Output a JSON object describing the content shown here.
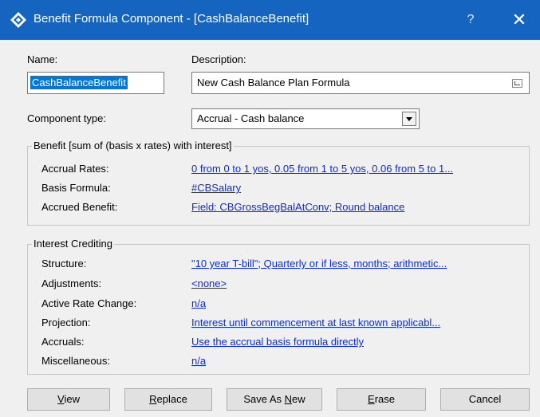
{
  "window": {
    "title": "Benefit Formula Component - [CashBalanceBenefit]",
    "help": "?",
    "close": "✕"
  },
  "colors": {
    "titlebar": "#1565c0",
    "link": "#0b2cdb",
    "selection": "#0078d7"
  },
  "name": {
    "label": "Name:",
    "value": "CashBalanceBenefit"
  },
  "description": {
    "label": "Description:",
    "value": "New Cash Balance Plan Formula"
  },
  "component_type": {
    "label": "Component type:",
    "value": "Accrual - Cash balance"
  },
  "benefit": {
    "title": "Benefit  [sum of (basis x rates) with interest]",
    "rows": [
      {
        "label": "Accrual Rates:",
        "value": "0 from 0 to 1 yos, 0.05 from 1 to 5 yos, 0.06 from 5 to 1..."
      },
      {
        "label": "Basis Formula:",
        "value": "#CBSalary"
      },
      {
        "label": "Accrued Benefit:",
        "value": "Field: CBGrossBegBalAtConv; Round balance"
      }
    ]
  },
  "interest": {
    "title": "Interest Crediting",
    "rows": [
      {
        "label": "Structure:",
        "value": "\"10 year T-bill\"; Quarterly or if less, months; arithmetic..."
      },
      {
        "label": "Adjustments:",
        "value": "<none>"
      },
      {
        "label": "Active Rate Change:",
        "value": "n/a"
      },
      {
        "label": "Projection:",
        "value": "Interest until commencement at last known applicabl..."
      },
      {
        "label": "Accruals:",
        "value": "Use the accrual basis formula directly"
      },
      {
        "label": "Miscellaneous:",
        "value": "n/a"
      }
    ]
  },
  "buttons": {
    "view": {
      "u": "V",
      "rest": "iew"
    },
    "replace": {
      "u": "R",
      "rest": "eplace"
    },
    "save_as_new": {
      "pre": "Save As ",
      "u": "N",
      "rest": "ew"
    },
    "erase": {
      "u": "E",
      "rest": "rase"
    },
    "cancel": "Cancel"
  }
}
